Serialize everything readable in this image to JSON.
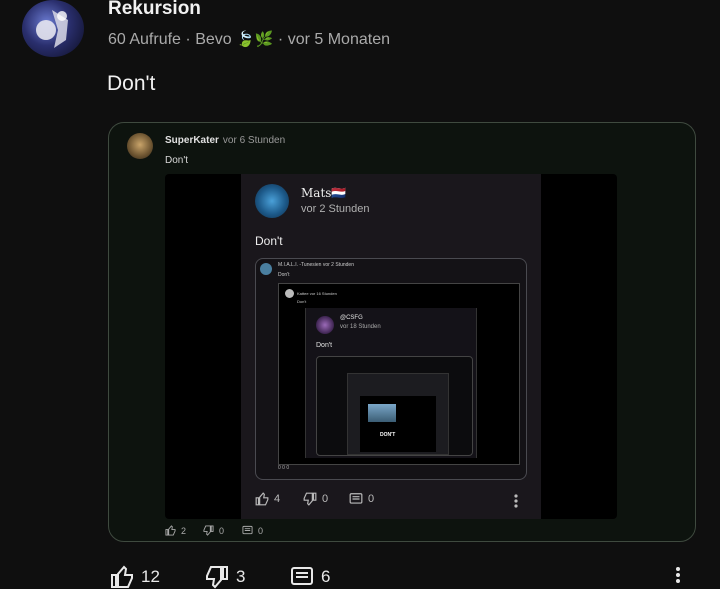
{
  "post": {
    "channel": "Rekursion",
    "views": "60 Aufrufe",
    "sep1": "·",
    "author": "Bevo",
    "author_emoji": "🍃🌿",
    "sep2": "·",
    "age": "vor 5 Monaten",
    "text": "Don't"
  },
  "embed": {
    "user": "SuperKater",
    "time": "vor 6 Stunden",
    "text": "Don't",
    "likes": "2",
    "dislikes": "0",
    "replies": "0",
    "screenshot": {
      "name": "Mats🇳🇱",
      "time": "vor 2 Stunden",
      "text": "Don't",
      "likes": "4",
      "dislikes": "0",
      "replies": "0",
      "nested": {
        "user": "M.I.A.L.I. -Tunesien",
        "time": "vor 2 Stunden",
        "text": "Don't",
        "deeper_user": "Kattee",
        "deeper_time": "vor 16 Stunden",
        "deeper_text": "Don't",
        "deepest_name": "@CSFG",
        "deepest_time": "vor 18 Stunden",
        "deepest_text": "Don't",
        "innermost_text": "DON'T",
        "actions": "0 0 0"
      }
    }
  },
  "actions": {
    "likes": "12",
    "dislikes": "3",
    "replies": "6"
  },
  "colors": {
    "background": "#0f0f0f",
    "card_border": "#3f4a3f",
    "card_bg": "#0d130e"
  }
}
